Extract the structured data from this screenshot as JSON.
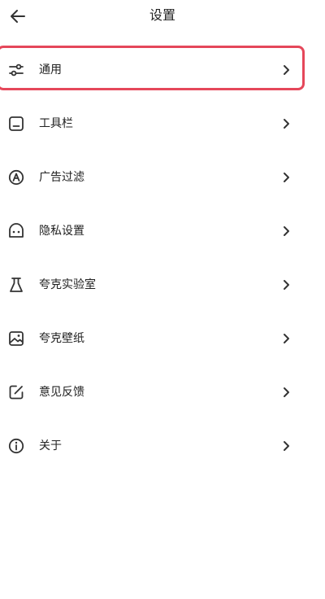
{
  "header": {
    "title": "设置",
    "back_icon": "arrow-left-icon"
  },
  "menu": {
    "items": [
      {
        "label": "通用",
        "icon": "sliders-icon",
        "highlighted": true
      },
      {
        "label": "工具栏",
        "icon": "toolbar-icon"
      },
      {
        "label": "广告过滤",
        "icon": "ad-filter-icon"
      },
      {
        "label": "隐私设置",
        "icon": "privacy-icon"
      },
      {
        "label": "夸克实验室",
        "icon": "flask-icon"
      },
      {
        "label": "夸克壁纸",
        "icon": "wallpaper-icon"
      },
      {
        "label": "意见反馈",
        "icon": "feedback-icon"
      },
      {
        "label": "关于",
        "icon": "info-icon"
      }
    ]
  },
  "colors": {
    "highlight": "#e5475a",
    "text": "#222222",
    "icon": "#333333"
  }
}
